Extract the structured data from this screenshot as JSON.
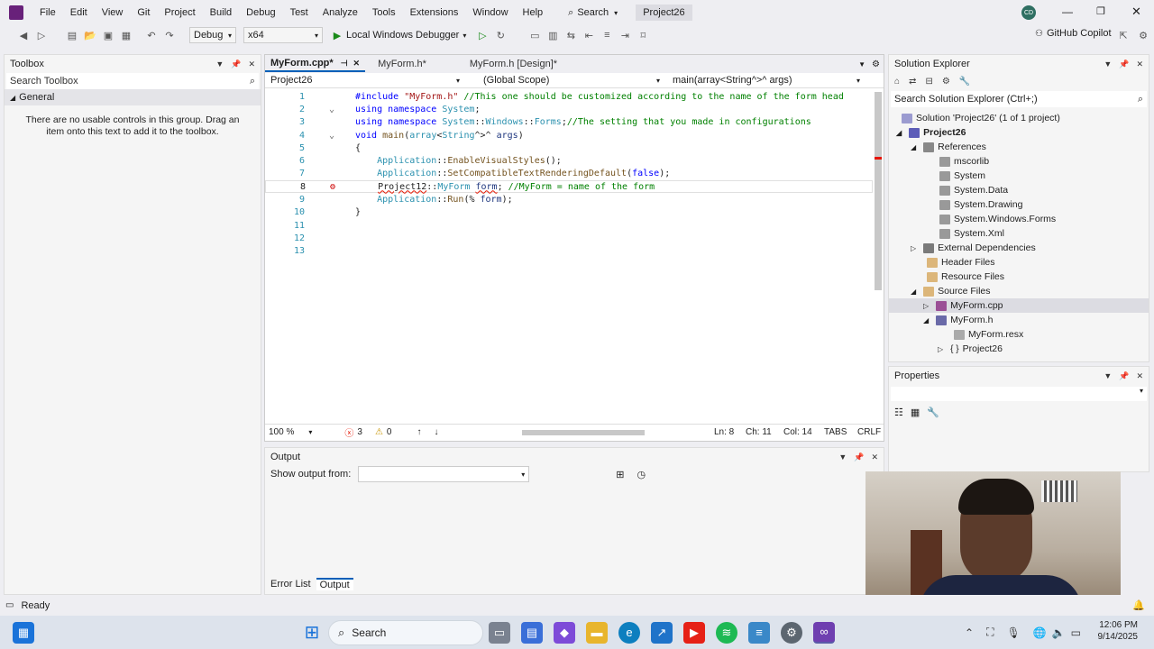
{
  "titlebar": {
    "menu": [
      "File",
      "Edit",
      "View",
      "Git",
      "Project",
      "Build",
      "Debug",
      "Test",
      "Analyze",
      "Tools",
      "Extensions",
      "Window",
      "Help"
    ],
    "search_label": "Search",
    "project_name": "Project26",
    "avatar_initials": "CD"
  },
  "toolbar": {
    "config": "Debug",
    "platform": "x64",
    "run_label": "Local Windows Debugger",
    "copilot": "GitHub Copilot"
  },
  "toolbox": {
    "title": "Toolbox",
    "search_placeholder": "Search Toolbox",
    "group": "General",
    "empty_msg": "There are no usable controls in this group. Drag an item onto this text to add it to the toolbox."
  },
  "editor": {
    "tabs": [
      "MyForm.cpp*",
      "MyForm.h*",
      "MyForm.h [Design]*"
    ],
    "nav_project": "Project26",
    "nav_scope": "(Global Scope)",
    "nav_member": "main(array<String^>^ args)",
    "status": {
      "zoom": "100 %",
      "errors": "3",
      "warnings": "0",
      "ln": "Ln: 8",
      "ch": "Ch: 11",
      "col": "Col: 14",
      "tabs": "TABS",
      "eol": "CRLF"
    }
  },
  "output": {
    "title": "Output",
    "show_from": "Show output from:",
    "bottom_tabs": [
      "Error List",
      "Output"
    ]
  },
  "solution_explorer": {
    "title": "Solution Explorer",
    "search_placeholder": "Search Solution Explorer (Ctrl+;)",
    "solution": "Solution 'Project26' (1 of 1 project)",
    "project": "Project26",
    "references": "References",
    "refs": [
      "mscorlib",
      "System",
      "System.Data",
      "System.Drawing",
      "System.Windows.Forms",
      "System.Xml"
    ],
    "external": "External Dependencies",
    "headers": "Header Files",
    "resources": "Resource Files",
    "sources": "Source Files",
    "myform_cpp": "MyForm.cpp",
    "myform_h": "MyForm.h",
    "myform_resx": "MyForm.resx",
    "project_ns": "Project26"
  },
  "properties": {
    "title": "Properties"
  },
  "statusbar": {
    "ready": "Ready"
  },
  "taskbar": {
    "search": "Search",
    "time": "12:06 PM",
    "date": "9/14/2025"
  }
}
